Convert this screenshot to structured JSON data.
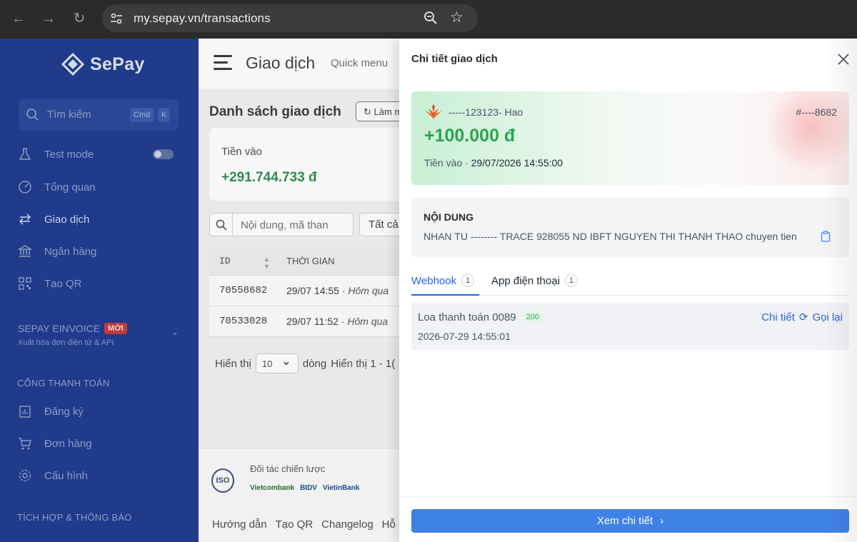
{
  "browser": {
    "url": "my.sepay.vn/transactions"
  },
  "sidebar": {
    "brand": "SePay",
    "search_placeholder": "Tìm kiếm",
    "kbd_cmd": "Cmd",
    "kbd_k": "K",
    "items": [
      {
        "label": "Test mode",
        "icon": "flask-icon"
      },
      {
        "label": "Tổng quan",
        "icon": "dashboard-gauge-icon"
      },
      {
        "label": "Giao dịch",
        "icon": "transfer-arrows-icon"
      },
      {
        "label": "Ngân hàng",
        "icon": "bank-icon"
      },
      {
        "label": "Tạo QR",
        "icon": "qr-icon"
      }
    ],
    "einvoice_title": "SEPAY EINVOICE",
    "einvoice_badge": "MỚI",
    "einvoice_sub": "Xuất hóa đơn điện tử & API",
    "payment_gateway_title": "CỔNG THANH TOÁN",
    "gateway_items": [
      {
        "label": "Đăng ký",
        "icon": "register-icon"
      },
      {
        "label": "Đơn hàng",
        "icon": "cart-icon"
      },
      {
        "label": "Cấu hình",
        "icon": "settings-icon"
      }
    ],
    "integration_title": "TÍCH HỢP & THÔNG BÁO"
  },
  "main": {
    "page_title": "Giao dịch",
    "quick_menu": "Quick menu",
    "list_title": "Danh sách giao dịch",
    "refresh_label": "Làm m",
    "stat_label": "Tiền vào",
    "stat_value": "+291.744.733 đ",
    "filter_placeholder": "Nội dung, mã than",
    "all_label": "Tất cả",
    "table": {
      "headers": [
        "ID",
        "THỜI GIAN"
      ],
      "rows": [
        {
          "id": "70558682",
          "time": "29/07 14:55",
          "rel": "· Hôm qua"
        },
        {
          "id": "70533028",
          "time": "29/07 11:52",
          "rel": "· Hôm qua"
        }
      ]
    },
    "pager": {
      "show": "Hiển thị",
      "per_page": "10",
      "rows": "dòng",
      "range": "Hiển thị 1 - 1("
    },
    "footer": {
      "partner_label": "Đối tác chiến lược",
      "iso": "ISO",
      "banks": [
        "Vietcombank",
        "BIDV",
        "VietinBank"
      ],
      "links": [
        "Hướng dẫn",
        "Tạo QR",
        "Changelog",
        "Hỗ"
      ]
    }
  },
  "drawer": {
    "title": "Chi tiết giao dịch",
    "account": "-----123123- Hao",
    "ref": "#----8682",
    "amount": "+100.000 đ",
    "meta_type": "Tiền vào",
    "meta_time": "29/07/2026 14:55:00",
    "content_heading": "NỘI DUNG",
    "content_text": "NHAN TU -------- TRACE 928055 ND IBFT NGUYEN THI THANH THAO chuyen tien",
    "tabs": [
      {
        "label": "Webhook",
        "count": "1"
      },
      {
        "label": "App điện thoại",
        "count": "1"
      }
    ],
    "webhook": {
      "name": "Loa thanh toán 0089",
      "status": "200",
      "time": "2026-07-29 14:55:01",
      "detail": "Chi tiết",
      "retry": "Gọi lại"
    },
    "primary_button": "Xem chi tiết"
  },
  "colors": {
    "sidebar": "#1f3b8a",
    "income_green": "#2ea350",
    "primary_blue": "#3f82e6"
  }
}
